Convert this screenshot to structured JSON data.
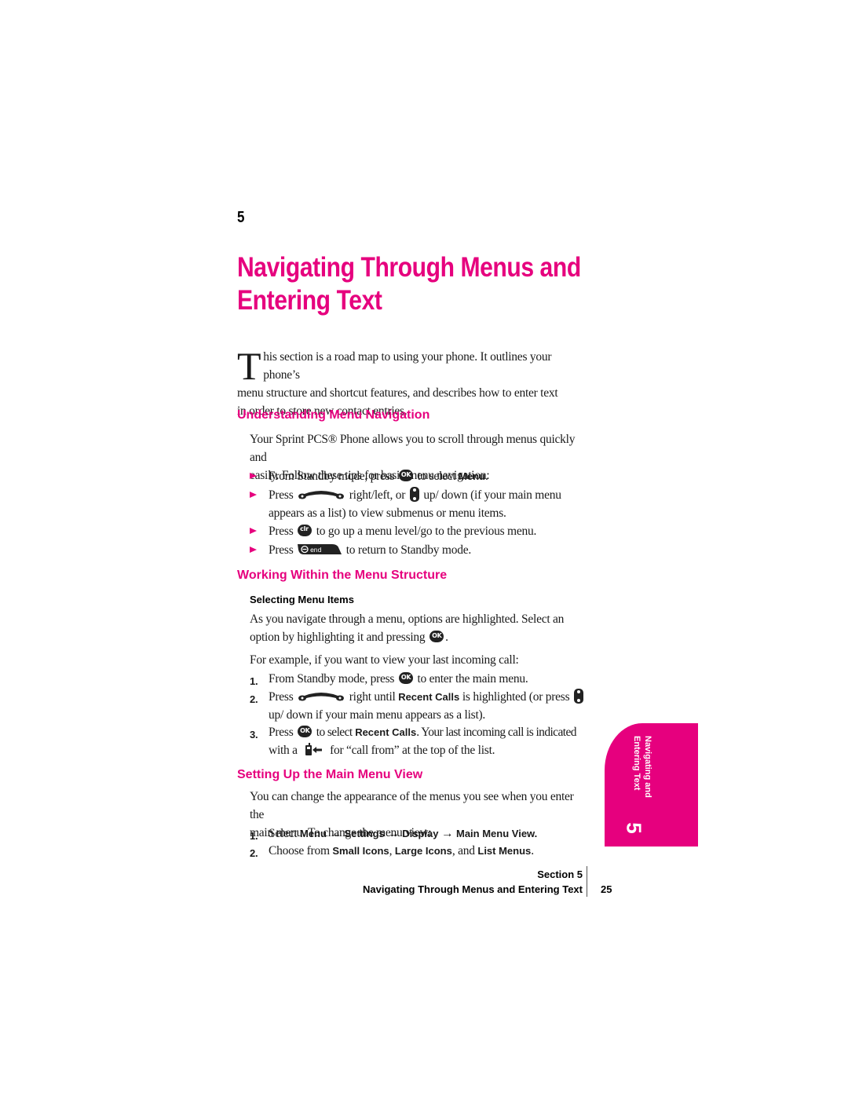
{
  "header": {
    "section_number": "5",
    "chapter_title_line1": "Navigating Through Menus and",
    "chapter_title_line2": "Entering Text"
  },
  "intro": {
    "drop_cap": "T",
    "line1": "his section is a road map to using your phone. It outlines your phone’s",
    "line2": "menu structure and shortcut features, and describes how to enter text",
    "line3": "in order to store new contact entries."
  },
  "sections": [
    {
      "heading": "Understanding Menu Navigation",
      "para_line1": "Your Sprint PCS® Phone allows you to scroll through menus quickly and",
      "para_line2": "easily. Follow these tips for basic menu navigation:",
      "bullets": [
        {
          "pre": "From Standby mode, press",
          "key": "ok-key-icon",
          "post": "to select",
          "bold": "Menu",
          "end": "."
        },
        {
          "pre": "Press",
          "key": "navigation-key-icon",
          "mid": "right/left, or",
          "key2": "up-down-key-icon",
          "post": "up/ down (if your main menu",
          "cont": "appears as a list) to view submenus or menu items."
        },
        {
          "pre": "Press",
          "key": "clr-key-icon",
          "post": "to go up a menu level/go to the previous menu."
        },
        {
          "pre": "Press",
          "key": "end-key-icon",
          "post": "to return to Standby mode."
        }
      ]
    },
    {
      "heading": "Working Within the Menu Structure",
      "subheading": "Selecting Menu Items",
      "para_line1": "As you navigate through a menu, options are highlighted. Select an",
      "para_line2": "option by highlighting it and pressing",
      "para_line2_end": ".",
      "example": "For example, if you want to view your last incoming call:",
      "steps": [
        {
          "n": "1.",
          "pre": "From Standby mode, press",
          "post": "to enter the main menu."
        },
        {
          "n": "2.",
          "pre": "Press",
          "mid": "right until",
          "bold": "Recent Calls",
          "post": "is highlighted (or press",
          "cont": "up/ down if your main menu appears as a list)."
        },
        {
          "n": "3.",
          "pre": "Press",
          "mid": "to select",
          "bold": "Recent Calls",
          "post": ". Your last incoming call is indicated",
          "cont_pre": "with a",
          "cont_post": "for “call from” at the top of the list."
        }
      ]
    },
    {
      "heading": "Setting Up the Main Menu View",
      "para_line1": "You can change the appearance of the menus you see when you enter the",
      "para_line2": "main menu. To change the menu view:",
      "steps": [
        {
          "n": "1.",
          "pre": "Select",
          "path": [
            "Menu",
            "Settings",
            "Display",
            "Main Menu View."
          ],
          "arrow": "→"
        },
        {
          "n": "2.",
          "pre": "Choose from",
          "opt1": "Small Icons",
          "sep1": ",",
          "opt2": "Large Icons",
          "sep2": ", and",
          "opt3": "List Menus",
          "end": "."
        }
      ]
    }
  ],
  "side_tab": {
    "label_line1": "Navigating and",
    "label_line2": "Entering Text",
    "number": "5"
  },
  "footer": {
    "section": "Section 5",
    "title": "Navigating Through Menus and Entering Text",
    "page_number": "25"
  },
  "colors": {
    "accent": "#e6007e",
    "text": "#1a1a1a"
  }
}
